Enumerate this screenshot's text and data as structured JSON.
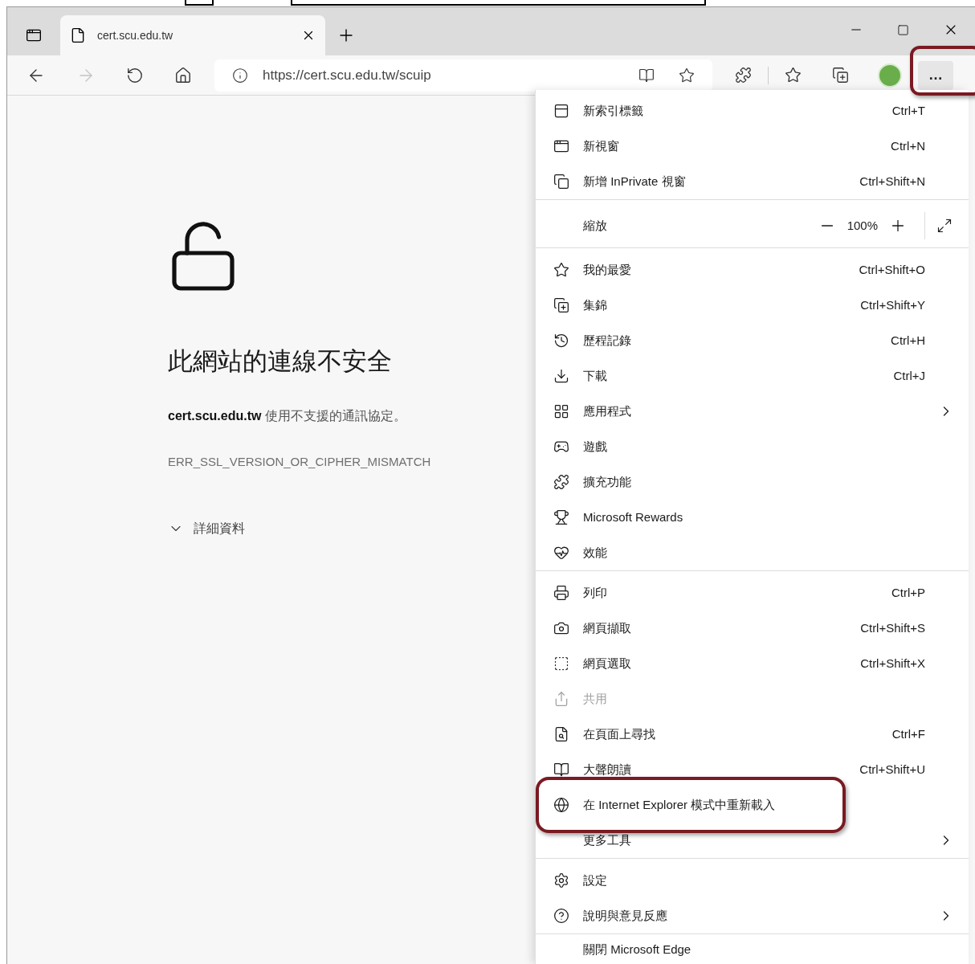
{
  "tab": {
    "title": "cert.scu.edu.tw",
    "selected": true
  },
  "toolbar": {
    "back_disabled": false,
    "forward_disabled": true,
    "url": "https://cert.scu.edu.tw/scuip",
    "more_button": {
      "label": "…",
      "highlighted": true
    }
  },
  "page": {
    "heading": "此網站的連線不安全",
    "message": "**cert.scu.edu.tw** 使用不支援的通訊協定。",
    "error_code": "ERR_SSL_VERSION_OR_CIPHER_MISMATCH",
    "details": "詳細資料"
  },
  "menu": {
    "sections": [
      {
        "items": [
          {
            "label": "新索引標籤",
            "shortcut": "Ctrl+T",
            "submenu": false,
            "disabled": false,
            "highlighted": false
          },
          {
            "label": "新視窗",
            "shortcut": "Ctrl+N",
            "submenu": false,
            "disabled": false,
            "highlighted": false
          },
          {
            "label": "新增 InPrivate 視窗",
            "shortcut": "Ctrl+Shift+N",
            "submenu": false,
            "disabled": false,
            "highlighted": false
          }
        ]
      },
      {
        "zoom": {
          "label": "縮放",
          "value": "100%"
        }
      },
      {
        "items": [
          {
            "label": "我的最愛",
            "shortcut": "Ctrl+Shift+O",
            "submenu": false,
            "disabled": false,
            "highlighted": false
          },
          {
            "label": "集錦",
            "shortcut": "Ctrl+Shift+Y",
            "submenu": false,
            "disabled": false,
            "highlighted": false
          },
          {
            "label": "歷程記錄",
            "shortcut": "Ctrl+H",
            "submenu": false,
            "disabled": false,
            "highlighted": false
          },
          {
            "label": "下載",
            "shortcut": "Ctrl+J",
            "submenu": false,
            "disabled": false,
            "highlighted": false
          },
          {
            "label": "應用程式",
            "submenu": true,
            "disabled": false,
            "highlighted": false
          },
          {
            "label": "遊戲",
            "submenu": false,
            "disabled": false,
            "highlighted": false
          },
          {
            "label": "擴充功能",
            "submenu": false,
            "disabled": false,
            "highlighted": false
          },
          {
            "label": "Microsoft Rewards",
            "submenu": false,
            "disabled": false,
            "highlighted": false
          },
          {
            "label": "效能",
            "submenu": false,
            "disabled": false,
            "highlighted": false
          }
        ]
      },
      {
        "items": [
          {
            "label": "列印",
            "shortcut": "Ctrl+P",
            "submenu": false,
            "disabled": false,
            "highlighted": false
          },
          {
            "label": "網頁擷取",
            "shortcut": "Ctrl+Shift+S",
            "submenu": false,
            "disabled": false,
            "highlighted": false
          },
          {
            "label": "網頁選取",
            "shortcut": "Ctrl+Shift+X",
            "submenu": false,
            "disabled": false,
            "highlighted": false
          },
          {
            "label": "共用",
            "submenu": false,
            "disabled": true,
            "highlighted": false
          },
          {
            "label": "在頁面上尋找",
            "shortcut": "Ctrl+F",
            "submenu": false,
            "disabled": false,
            "highlighted": false
          },
          {
            "label": "大聲朗讀",
            "shortcut": "Ctrl+Shift+U",
            "submenu": false,
            "disabled": false,
            "highlighted": false
          },
          {
            "label": "在 Internet Explorer 模式中重新載入",
            "submenu": false,
            "disabled": false,
            "highlighted": true
          },
          {
            "label": "更多工具",
            "submenu": true,
            "disabled": false,
            "highlighted": false
          }
        ]
      },
      {
        "items": [
          {
            "label": "設定",
            "submenu": false,
            "disabled": false,
            "highlighted": false
          },
          {
            "label": "說明與意見反應",
            "submenu": true,
            "disabled": false,
            "highlighted": false
          }
        ]
      },
      {
        "items": [
          {
            "label": "關閉 Microsoft Edge",
            "submenu": false,
            "disabled": false,
            "highlighted": false
          }
        ]
      }
    ]
  }
}
